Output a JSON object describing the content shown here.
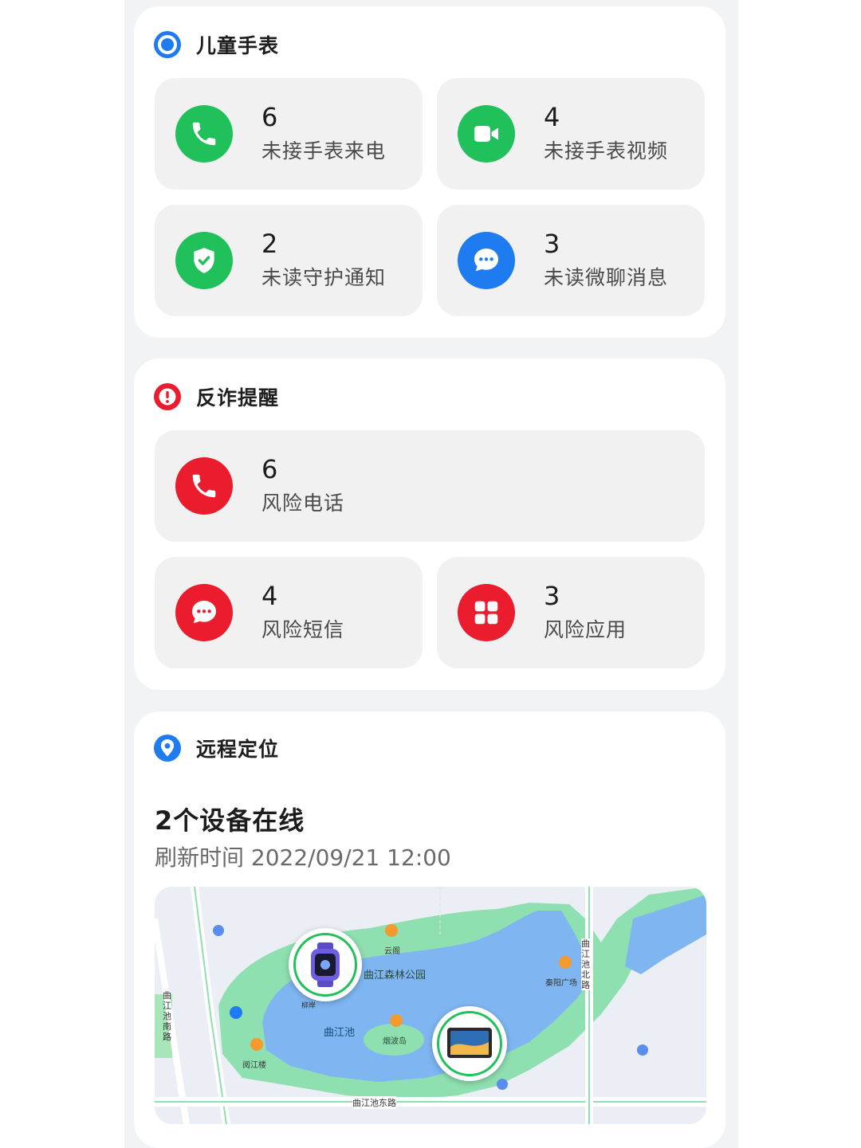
{
  "watch_section": {
    "title": "儿童手表",
    "tiles": [
      {
        "count": "6",
        "label": "未接手表来电",
        "icon": "phone-icon",
        "color": "#20c05a"
      },
      {
        "count": "4",
        "label": "未接手表视频",
        "icon": "video-icon",
        "color": "#20c05a"
      },
      {
        "count": "2",
        "label": "未读守护通知",
        "icon": "shield-icon",
        "color": "#20c05a"
      },
      {
        "count": "3",
        "label": "未读微聊消息",
        "icon": "chat-icon",
        "color": "#1e7cf0"
      }
    ]
  },
  "fraud_section": {
    "title": "反诈提醒",
    "tiles": [
      {
        "count": "6",
        "label": "风险电话",
        "icon": "phone-icon",
        "color": "#ea1c2d"
      },
      {
        "count": "4",
        "label": "风险短信",
        "icon": "chat-icon",
        "color": "#ea1c2d"
      },
      {
        "count": "3",
        "label": "风险应用",
        "icon": "apps-grid-icon",
        "color": "#ea1c2d"
      }
    ]
  },
  "location_section": {
    "title": "远程定位",
    "online_text": "2个设备在线",
    "refresh_text": "刷新时间 2022/09/21 12:00",
    "map": {
      "labels": {
        "park": "曲江森林公园",
        "lake": "曲江池",
        "island": "烟波岛",
        "yunge": "云阁",
        "pavilion": "阅江楼",
        "plaza": "秦阳广场",
        "road_south": "曲江池东路",
        "road_west": "曲江池南路",
        "road_north": "曲江池北路",
        "small": "柳岸"
      }
    }
  },
  "colors": {
    "green": "#20c05a",
    "blue": "#1e7cf0",
    "red": "#ea1c2d",
    "map_water": "#7fb6f2",
    "map_park": "#8fe0b0"
  }
}
